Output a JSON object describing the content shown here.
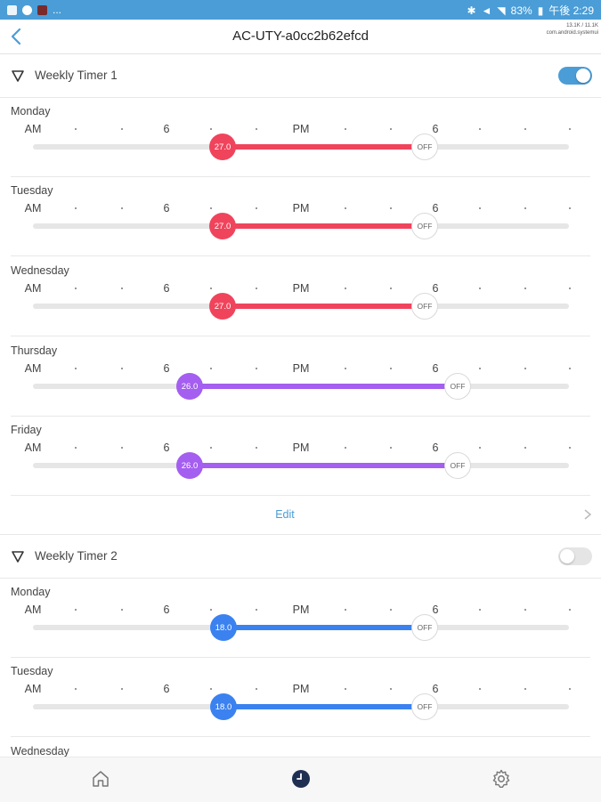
{
  "status_bar": {
    "dots": "...",
    "battery": "83%",
    "time_text": "午後 2:29"
  },
  "nav": {
    "title": "AC-UTY-a0cc2b62efcd",
    "debug_line1": "13.1K / 11.1K",
    "debug_line2": "com.android.systemui"
  },
  "axis": {
    "am": "AM",
    "six_am": "6",
    "pm": "PM",
    "six_pm": "6"
  },
  "colors": {
    "accent": "#4a9dd6",
    "heat": "#f0445c",
    "dry": "#a45ef0",
    "cool": "#3b82f0"
  },
  "timers": [
    {
      "name": "Weekly Timer 1",
      "enabled": true,
      "days": [
        {
          "name": "Monday",
          "temp": "27.0",
          "off": "OFF",
          "mode": "heat"
        },
        {
          "name": "Tuesday",
          "temp": "27.0",
          "off": "OFF",
          "mode": "heat"
        },
        {
          "name": "Wednesday",
          "temp": "27.0",
          "off": "OFF",
          "mode": "heat"
        },
        {
          "name": "Thursday",
          "temp": "26.0",
          "off": "OFF",
          "mode": "dry"
        },
        {
          "name": "Friday",
          "temp": "26.0",
          "off": "OFF",
          "mode": "dry"
        }
      ],
      "edit_label": "Edit"
    },
    {
      "name": "Weekly Timer 2",
      "enabled": false,
      "days": [
        {
          "name": "Monday",
          "temp": "18.0",
          "off": "OFF",
          "mode": "cool"
        },
        {
          "name": "Tuesday",
          "temp": "18.0",
          "off": "OFF",
          "mode": "cool"
        },
        {
          "name": "Wednesday",
          "temp": "",
          "off": "",
          "mode": "cool"
        }
      ]
    }
  ],
  "tabs": [
    {
      "icon": "home-icon"
    },
    {
      "icon": "clock-icon",
      "active": true
    },
    {
      "icon": "gear-icon"
    }
  ]
}
